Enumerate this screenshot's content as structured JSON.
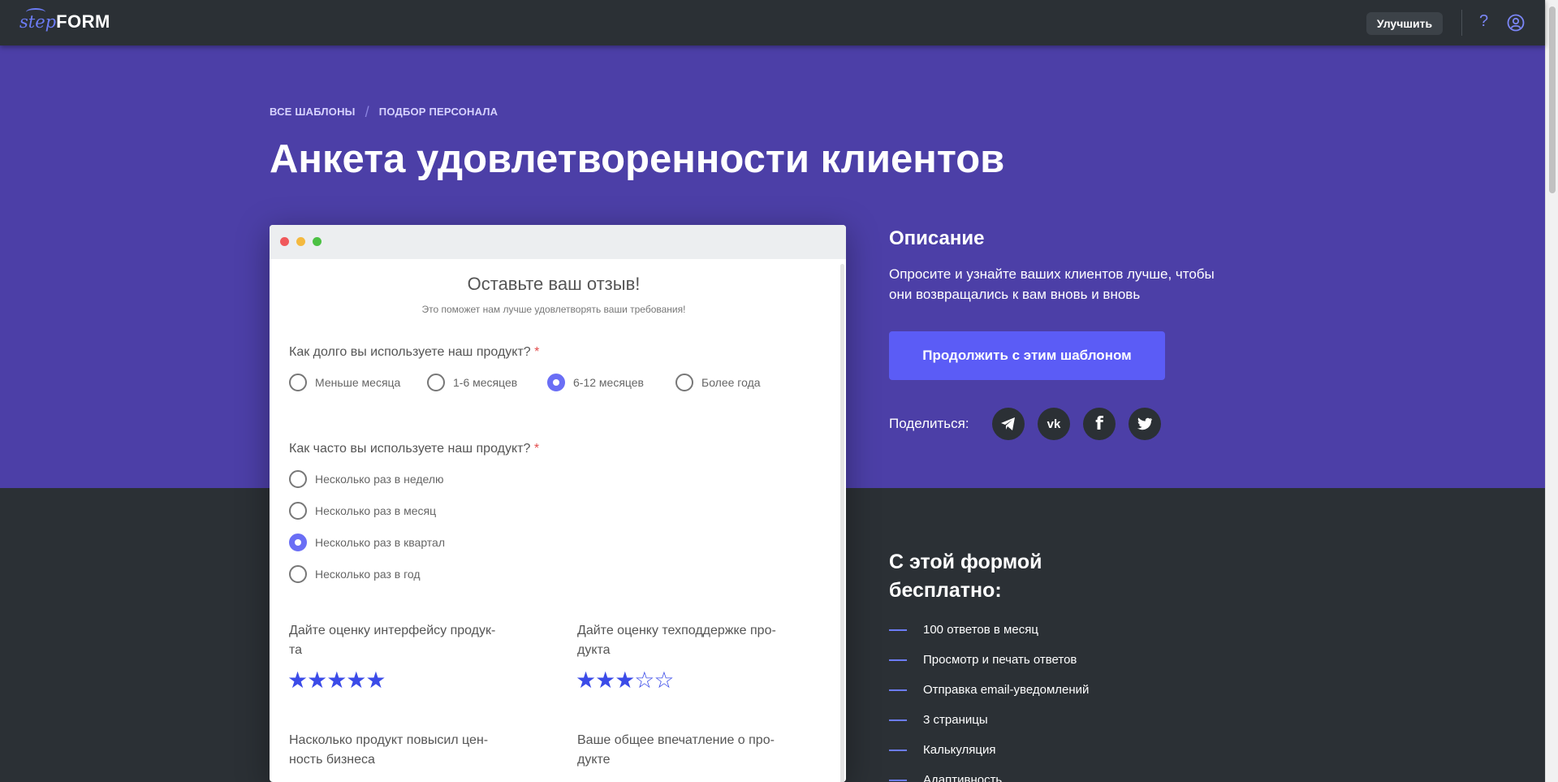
{
  "header": {
    "logo_step": "step",
    "logo_form": "FORM",
    "upgrade_label": "Улучшить",
    "help_glyph": "?"
  },
  "breadcrumb": {
    "all_templates": "ВСЕ ШАБЛОНЫ",
    "separator": "/",
    "category": "ПОДБОР ПЕРСОНАЛА"
  },
  "page_title": "Анкета удовлетворенности клиентов",
  "preview": {
    "title": "Оставьте ваш отзыв!",
    "subtitle": "Это поможет нам лучше удовлетворять ваши требования!",
    "q1": {
      "label": "Как долго вы используете наш продукт?",
      "required_mark": "*",
      "options": [
        "Меньше месяца",
        "1-6 месяцев",
        "6-12 месяцев",
        "Более года"
      ],
      "selected": "6-12 месяцев"
    },
    "q2": {
      "label": "Как часто вы используете наш продукт?",
      "required_mark": "*",
      "options": [
        "Несколько раз в неделю",
        "Несколько раз в месяц",
        "Несколько раз в квартал",
        "Несколько раз в год"
      ],
      "selected": "Несколько раз в квартал"
    },
    "ratings": [
      {
        "label_line1": "Дайте оценку интерфейсу продук-",
        "label_line2": "та",
        "stars": "★★★★★",
        "value": 5,
        "max": 5
      },
      {
        "label_line1": "Дайте оценку техподдержке про-",
        "label_line2": "дукта",
        "stars": "★★★☆☆",
        "value": 3,
        "max": 5
      },
      {
        "label_line1": "Насколько продукт повысил цен-",
        "label_line2": "ность бизнеса"
      },
      {
        "label_line1": "Ваше общее впечатление о про-",
        "label_line2": "дукте"
      }
    ]
  },
  "description": {
    "title": "Описание",
    "text": "Опросите и узнайте ваших клиентов лучше, чтобы они возвращались к вам вновь и вновь",
    "continue_label": "Продолжить с этим шаблоном",
    "share_label": "Поделиться:",
    "share_icons": [
      "telegram-icon",
      "vk-icon",
      "facebook-icon",
      "twitter-icon"
    ],
    "vk_glyph": "vk",
    "facebook_glyph": "f"
  },
  "free_plan": {
    "title_line1": "С этой формой",
    "title_line2": "бесплатно:",
    "features": [
      "100 ответов в месяц",
      "Просмотр и печать ответов",
      "Отправка email-уведомлений",
      "3 страницы",
      "Калькуляция",
      "Адаптивность"
    ]
  },
  "colors": {
    "hero_bg": "#4c3fa7",
    "dark_bg": "#2b3035",
    "accent": "#5b5cf6",
    "star": "#3b4be8"
  }
}
